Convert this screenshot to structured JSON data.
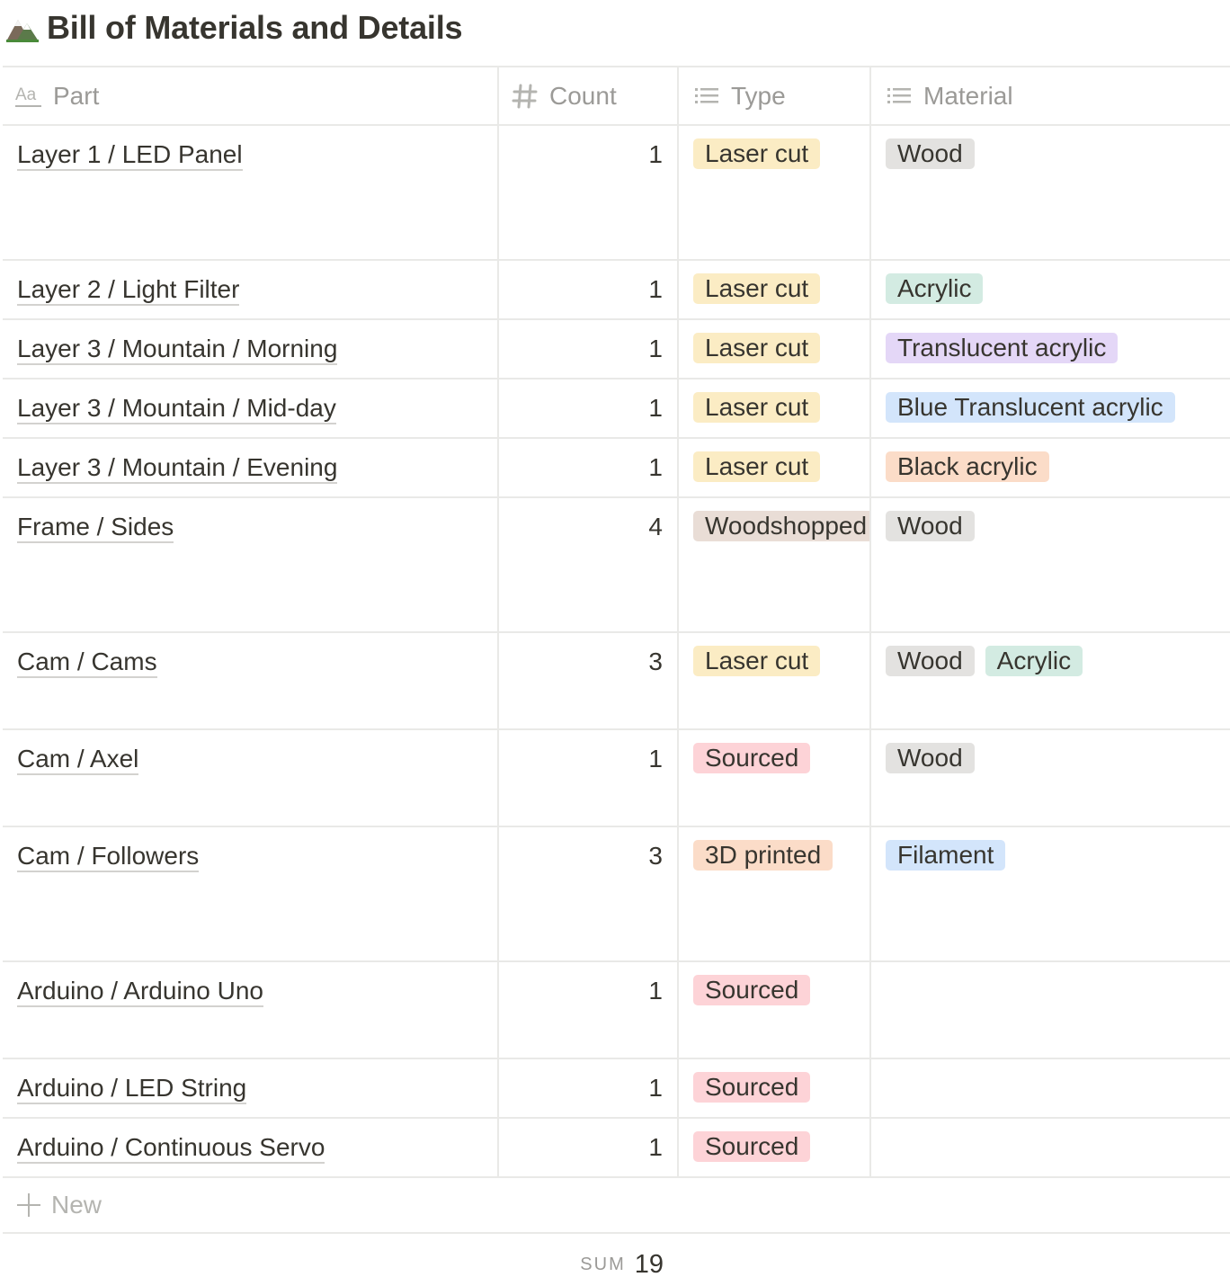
{
  "page": {
    "title": "Bill of Materials and Details",
    "title_icon": "mountain-icon"
  },
  "columns": [
    {
      "label": "Part",
      "icon": "text-property-icon"
    },
    {
      "label": "Count",
      "icon": "number-property-icon"
    },
    {
      "label": "Type",
      "icon": "select-property-icon"
    },
    {
      "label": "Material",
      "icon": "multiselect-property-icon"
    }
  ],
  "tag_colors": {
    "yellow": "#fbf3db",
    "gray": "#e3e2e0",
    "green": "#ddedea",
    "purple": "#e8deee",
    "blue": "#ddebf1",
    "orange": "#faebdd",
    "brown": "#e9e5e3",
    "red": "#ffe2dd"
  },
  "rows": [
    {
      "part": "Layer 1 / LED Panel",
      "count": "1",
      "type": {
        "label": "Laser cut",
        "color": "#fbecc4"
      },
      "materials": [
        {
          "label": "Wood",
          "color": "#e3e2e0"
        }
      ]
    },
    {
      "part": "Layer 2 / Light Filter",
      "count": "1",
      "type": {
        "label": "Laser cut",
        "color": "#fbecc4"
      },
      "materials": [
        {
          "label": "Acrylic",
          "color": "#d3ebe2"
        }
      ]
    },
    {
      "part": "Layer 3 / Mountain / Morning",
      "count": "1",
      "type": {
        "label": "Laser cut",
        "color": "#fbecc4"
      },
      "materials": [
        {
          "label": "Translucent acrylic",
          "color": "#e4d7f7"
        }
      ]
    },
    {
      "part": "Layer 3 / Mountain / Mid-day",
      "count": "1",
      "type": {
        "label": "Laser cut",
        "color": "#fbecc4"
      },
      "materials": [
        {
          "label": "Blue Translucent acrylic",
          "color": "#d3e5fb"
        }
      ]
    },
    {
      "part": "Layer 3 / Mountain / Evening",
      "count": "1",
      "type": {
        "label": "Laser cut",
        "color": "#fbecc4"
      },
      "materials": [
        {
          "label": "Black acrylic",
          "color": "#fbdcc8"
        }
      ]
    },
    {
      "part": "Frame / Sides",
      "count": "4",
      "type": {
        "label": "Woodshopped",
        "color": "#e9ddd6"
      },
      "materials": [
        {
          "label": "Wood",
          "color": "#e3e2e0"
        }
      ]
    },
    {
      "part": "Cam / Cams",
      "count": "3",
      "type": {
        "label": "Laser cut",
        "color": "#fbecc4"
      },
      "materials": [
        {
          "label": "Wood",
          "color": "#e3e2e0"
        },
        {
          "label": "Acrylic",
          "color": "#d3ebe2"
        }
      ]
    },
    {
      "part": "Cam / Axel",
      "count": "1",
      "type": {
        "label": "Sourced",
        "color": "#fdd3d7"
      },
      "materials": [
        {
          "label": "Wood",
          "color": "#e3e2e0"
        }
      ]
    },
    {
      "part": "Cam / Followers",
      "count": "3",
      "type": {
        "label": "3D printed",
        "color": "#fbdcc8"
      },
      "materials": [
        {
          "label": "Filament",
          "color": "#d3e5fb"
        }
      ]
    },
    {
      "part": "Arduino / Arduino Uno",
      "count": "1",
      "type": {
        "label": "Sourced",
        "color": "#fdd3d7"
      },
      "materials": []
    },
    {
      "part": "Arduino / LED String",
      "count": "1",
      "type": {
        "label": "Sourced",
        "color": "#fdd3d7"
      },
      "materials": []
    },
    {
      "part": "Arduino / Continuous Servo",
      "count": "1",
      "type": {
        "label": "Sourced",
        "color": "#fdd3d7"
      },
      "materials": []
    }
  ],
  "new_row": {
    "label": "New"
  },
  "footer": {
    "sum_label": "SUM",
    "sum_value": "19"
  }
}
